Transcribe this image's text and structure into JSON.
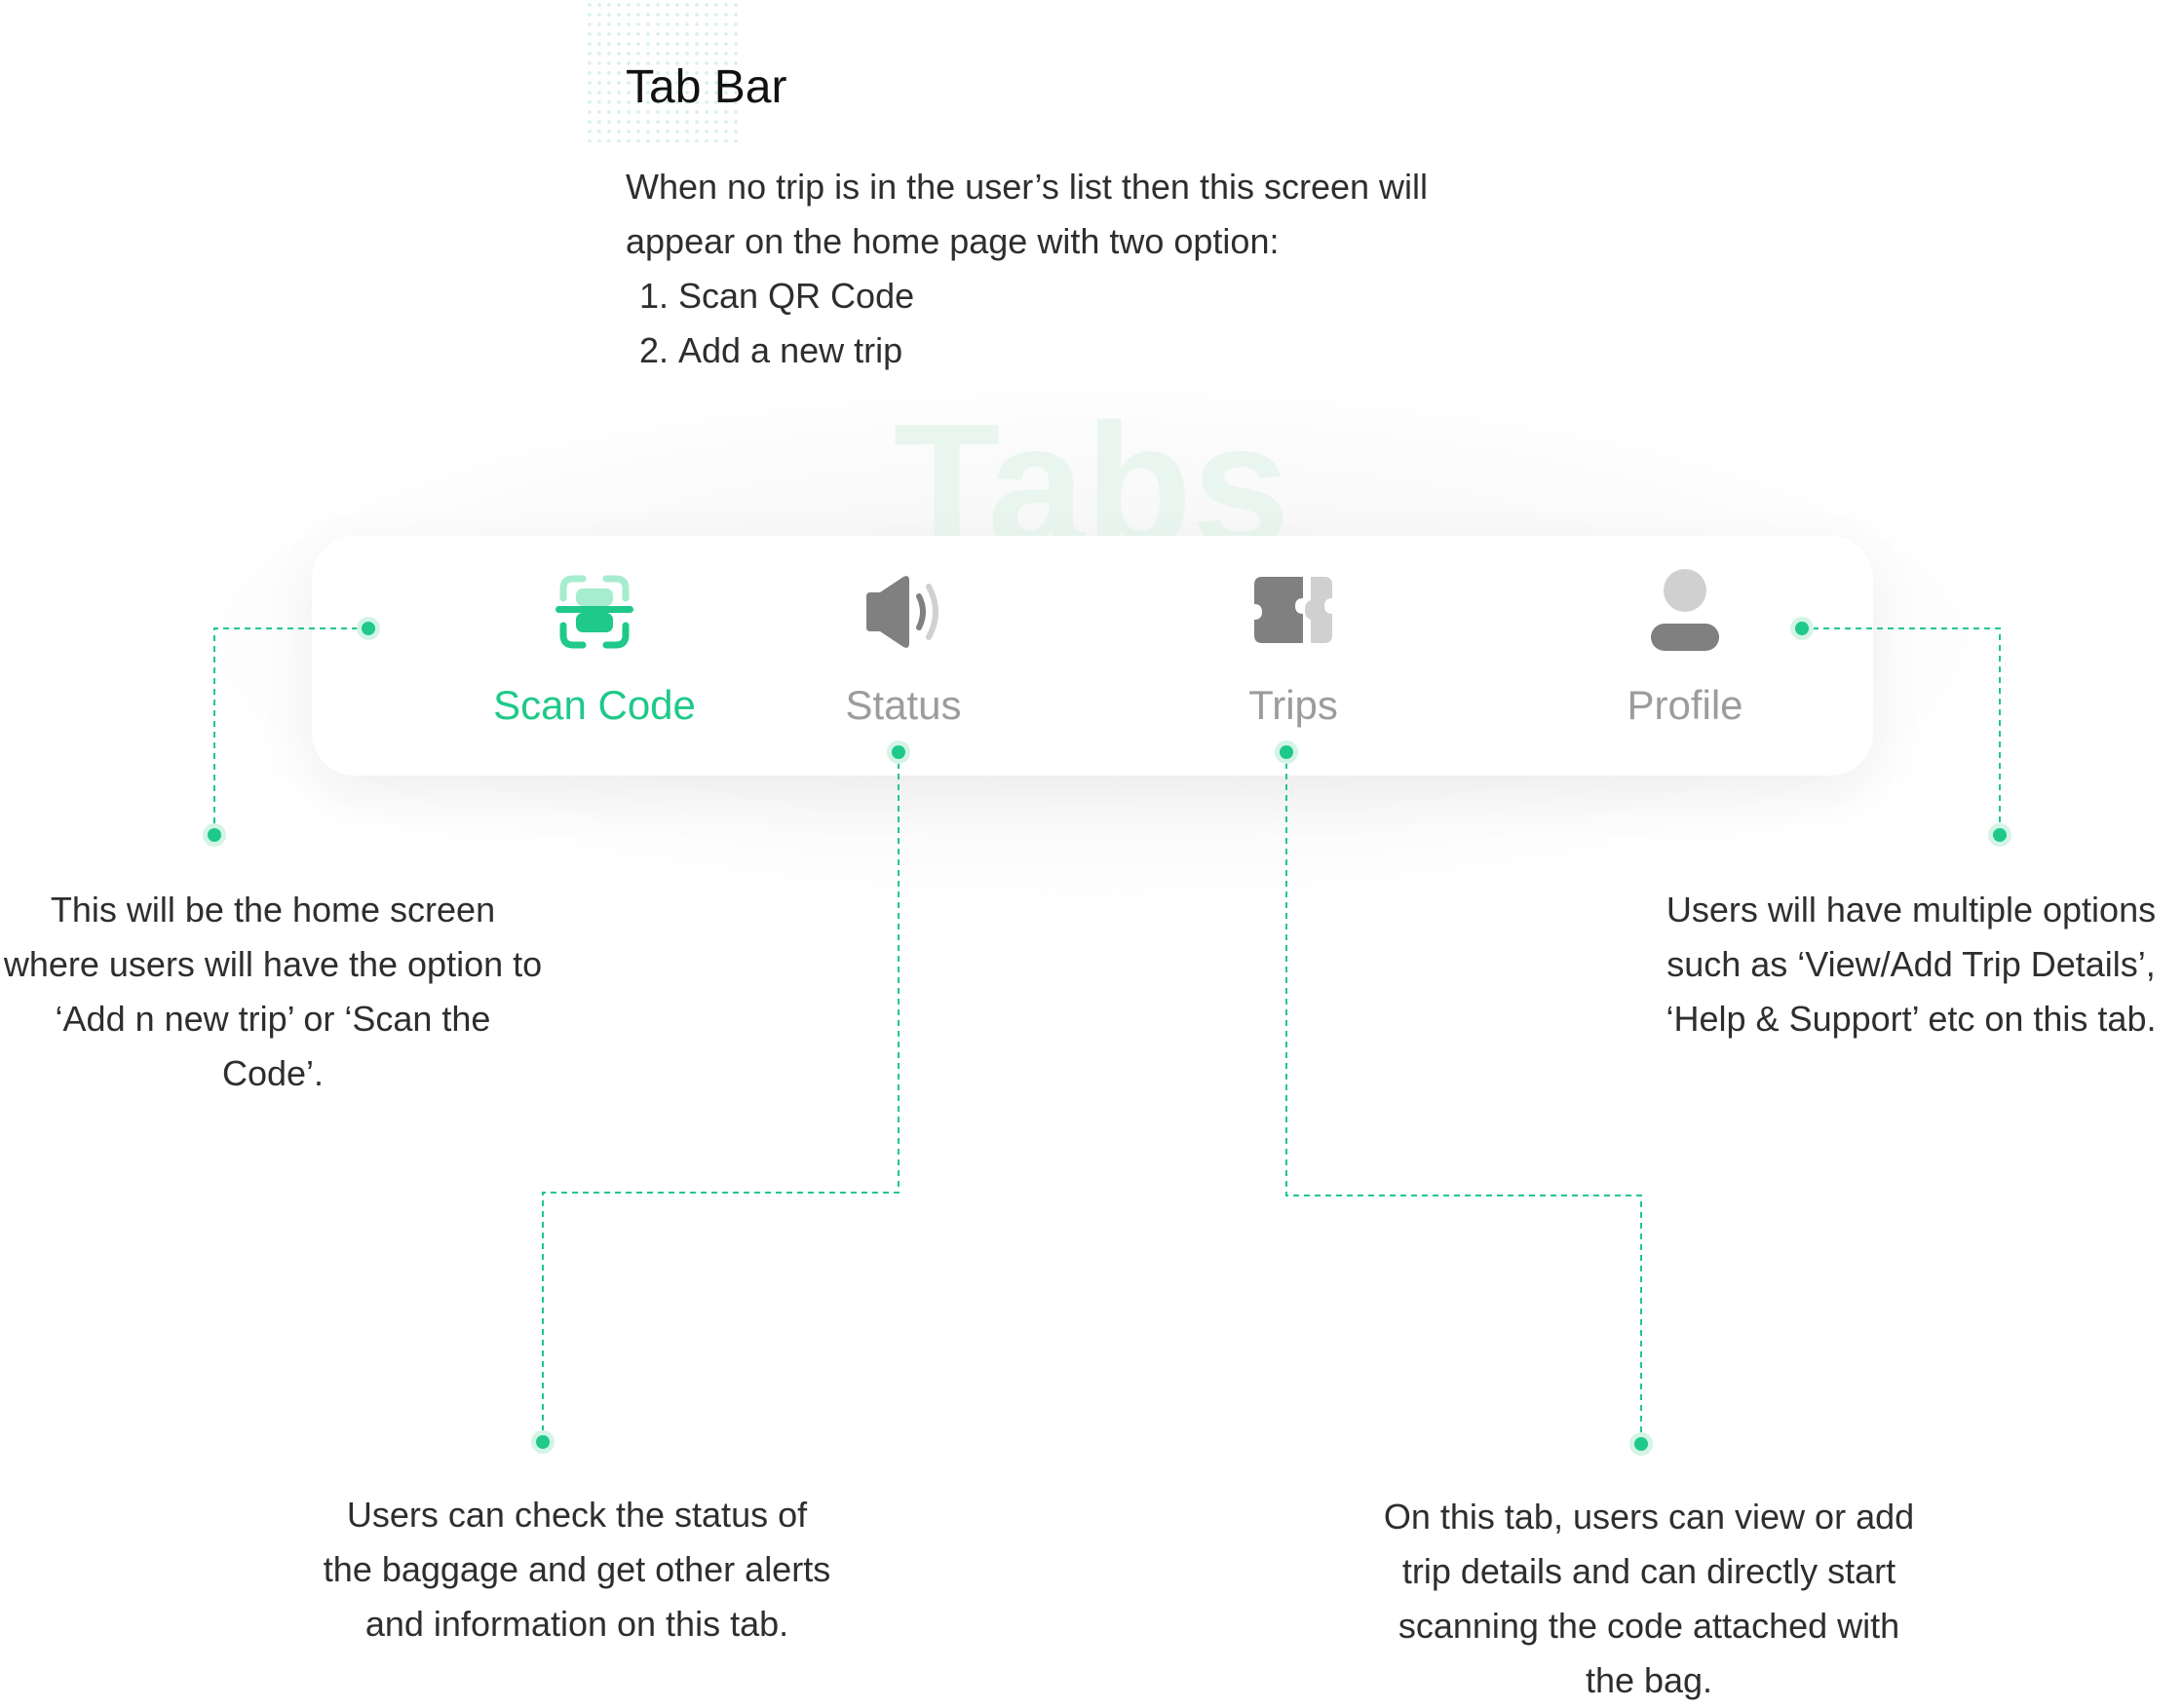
{
  "header": {
    "title": "Tab Bar",
    "intro": "When no trip is in the user’s list then this screen will appear on the home page with two option:",
    "options": [
      "Scan QR Code",
      "Add a new trip"
    ]
  },
  "watermark": "Tabs",
  "tabs": [
    {
      "label": "Scan Code",
      "icon": "scan-code-icon",
      "active": true
    },
    {
      "label": "Status",
      "icon": "speaker-icon",
      "active": false
    },
    {
      "label": "Trips",
      "icon": "ticket-icon",
      "active": false
    },
    {
      "label": "Profile",
      "icon": "user-icon",
      "active": false
    }
  ],
  "notes": {
    "scan": "This will be the home screen where users will have the option to ‘Add n new trip’ or ‘Scan the Code’.",
    "profile": "Users will have multiple options such as ‘View/Add Trip Details’, ‘Help & Support’ etc on this tab.",
    "status": "Users can check the status of the baggage and get other alerts and information on this tab.",
    "trips": "On this tab, users can view or add trip details and can directly start scanning the code attached with the bag."
  },
  "colors": {
    "accent": "#1ec98a",
    "accent_light": "#a6eccf",
    "icon_gray": "#808080",
    "icon_light": "#d0d0d0"
  }
}
